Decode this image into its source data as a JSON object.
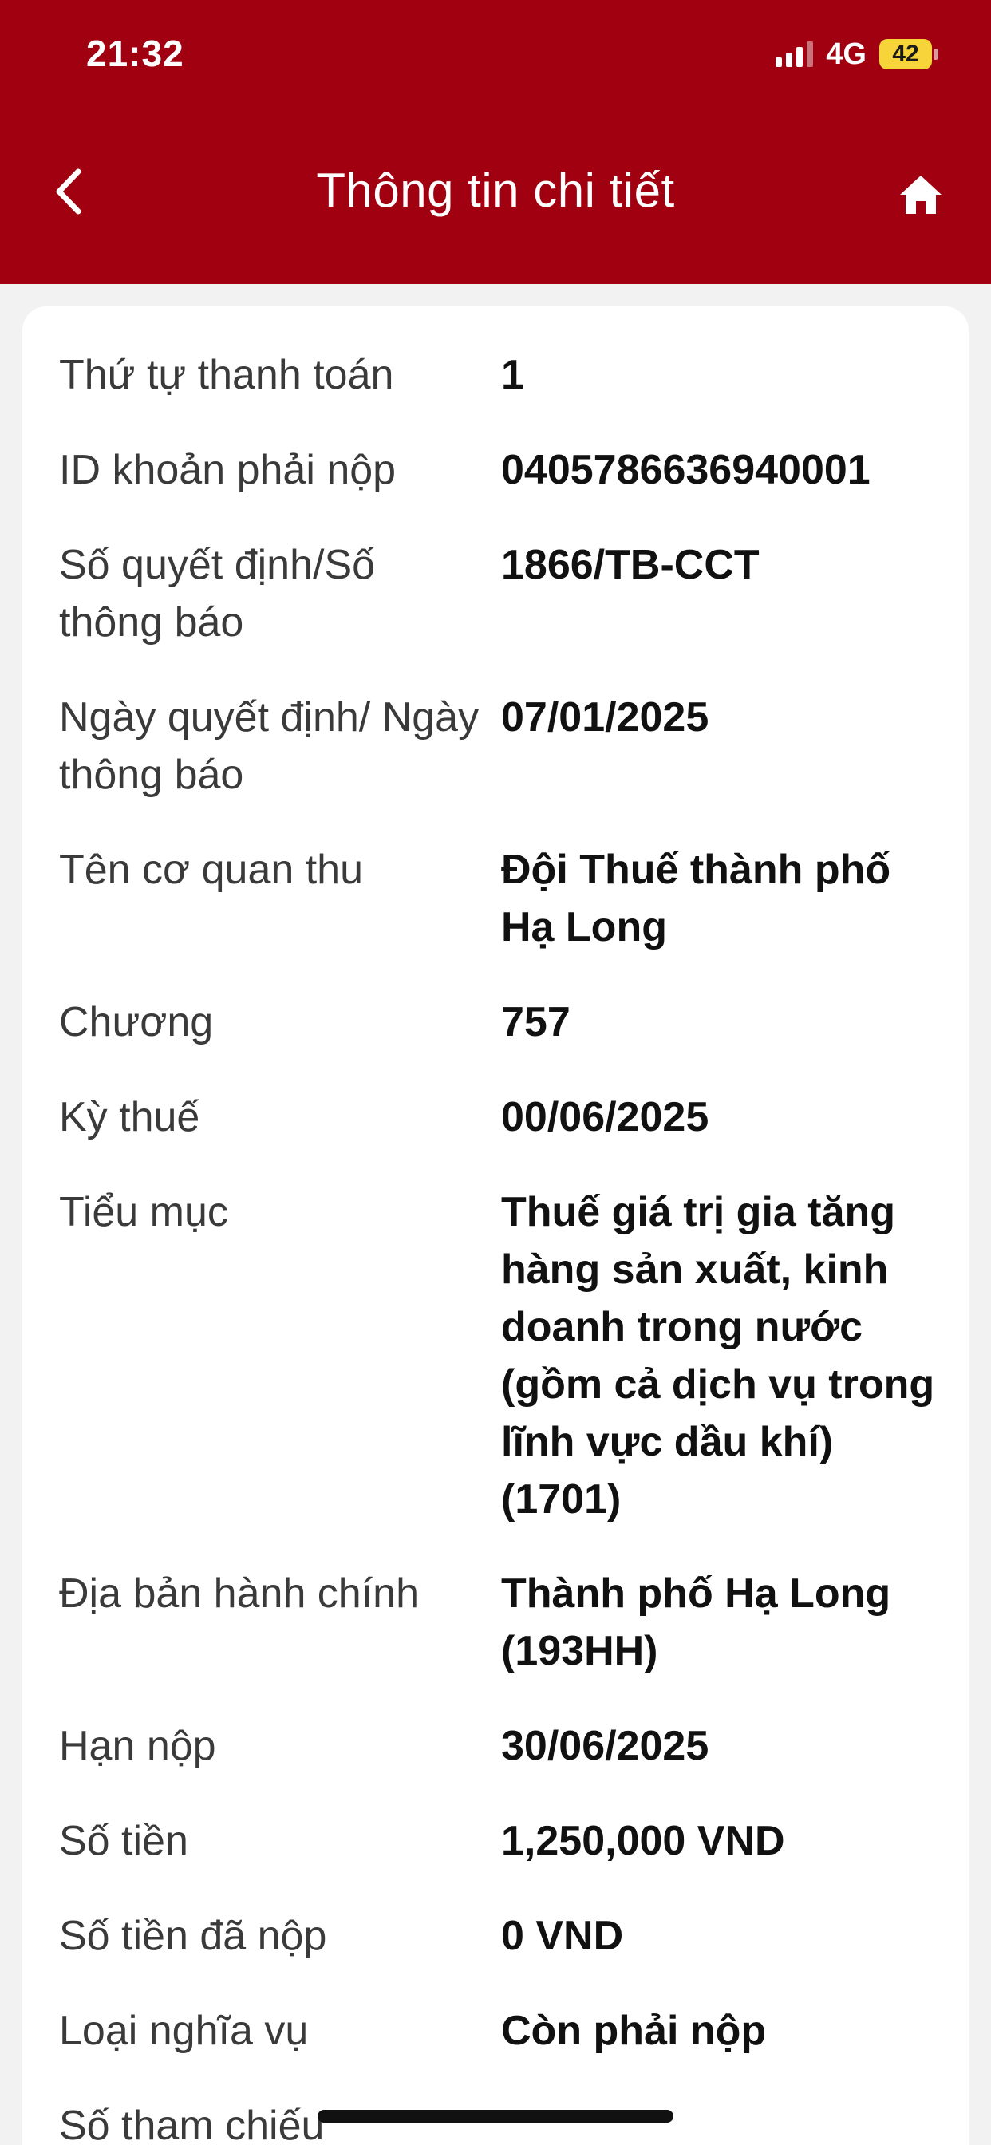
{
  "status_bar": {
    "time": "21:32",
    "network": "4G",
    "battery": "42",
    "battery_color": "#f7d43a"
  },
  "header": {
    "title": "Thông tin chi tiết",
    "back_icon": "chevron-left-icon",
    "home_icon": "home-icon",
    "background": "#a0000f"
  },
  "details": [
    {
      "label": "Thứ tự thanh toán",
      "value": "1"
    },
    {
      "label": "ID khoản phải nộp",
      "value": "0405786636940001"
    },
    {
      "label": "Số quyết định/Số thông báo",
      "value": "1866/TB-CCT"
    },
    {
      "label": "Ngày quyết định/ Ngày thông báo",
      "value": "07/01/2025"
    },
    {
      "label": "Tên cơ quan thu",
      "value": "Đội Thuế thành phố Hạ Long"
    },
    {
      "label": "Chương",
      "value": "757"
    },
    {
      "label": "Kỳ thuế",
      "value": "00/06/2025"
    },
    {
      "label": "Tiểu mục",
      "value": "Thuế giá trị gia tăng hàng sản xuất, kinh doanh trong nước (gồm cả dịch vụ trong lĩnh vực dầu khí) (1701)"
    },
    {
      "label": "Địa bản hành chính",
      "value": "Thành phố Hạ Long (193HH)"
    },
    {
      "label": "Hạn nộp",
      "value": "30/06/2025"
    },
    {
      "label": "Số tiền",
      "value": "1,250,000 VND"
    },
    {
      "label": "Số tiền đã nộp",
      "value": "0 VND"
    },
    {
      "label": "Loại nghĩa vụ",
      "value": "Còn phải nộp"
    },
    {
      "label": "Số tham chiếu",
      "value": ""
    }
  ]
}
